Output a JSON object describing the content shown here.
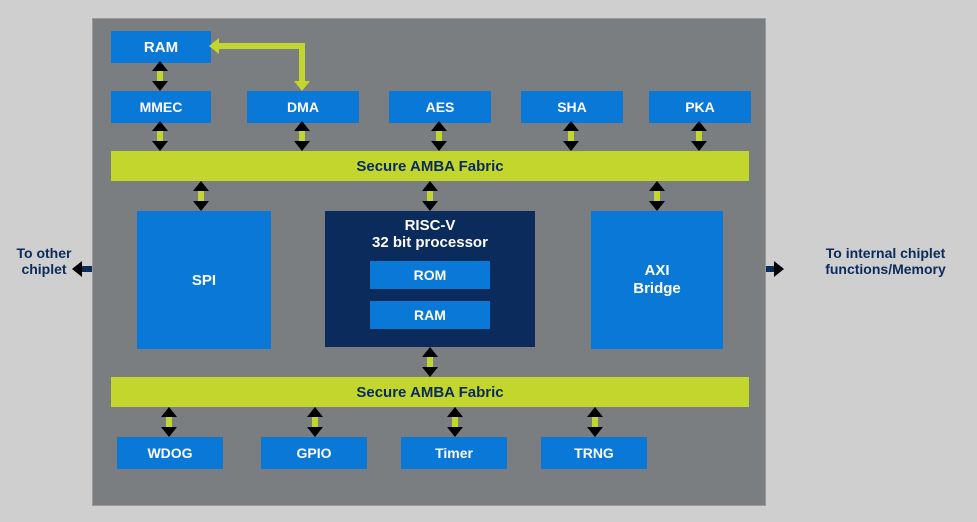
{
  "external": {
    "left_label": "To other chiplet",
    "right_label": "To internal chiplet functions/Memory"
  },
  "top": {
    "ram": "RAM",
    "row": {
      "mmec": "MMEC",
      "dma": "DMA",
      "aes": "AES",
      "sha": "SHA",
      "pka": "PKA"
    }
  },
  "fabric": {
    "upper": "Secure AMBA Fabric",
    "lower": "Secure AMBA Fabric"
  },
  "mid": {
    "spi": "SPI",
    "riscv": {
      "title1": "RISC-V",
      "title2": "32 bit processor",
      "rom": "ROM",
      "ram": "RAM"
    },
    "axi": {
      "line1": "AXI",
      "line2": "Bridge"
    }
  },
  "bottom": {
    "wdog": "WDOG",
    "gpio": "GPIO",
    "timer": "Timer",
    "trng": "TRNG"
  },
  "icons": {
    "arrow_left": "arrow-left-icon",
    "arrow_right": "arrow-right-icon",
    "arrow_up": "arrow-up-icon",
    "arrow_down": "arrow-down-icon"
  },
  "colors": {
    "blue": "#0a78d6",
    "darknavy": "#0a2b5b",
    "lime": "#c3d62d",
    "panel": "#7b7e80",
    "page": "#cfcfcf"
  }
}
